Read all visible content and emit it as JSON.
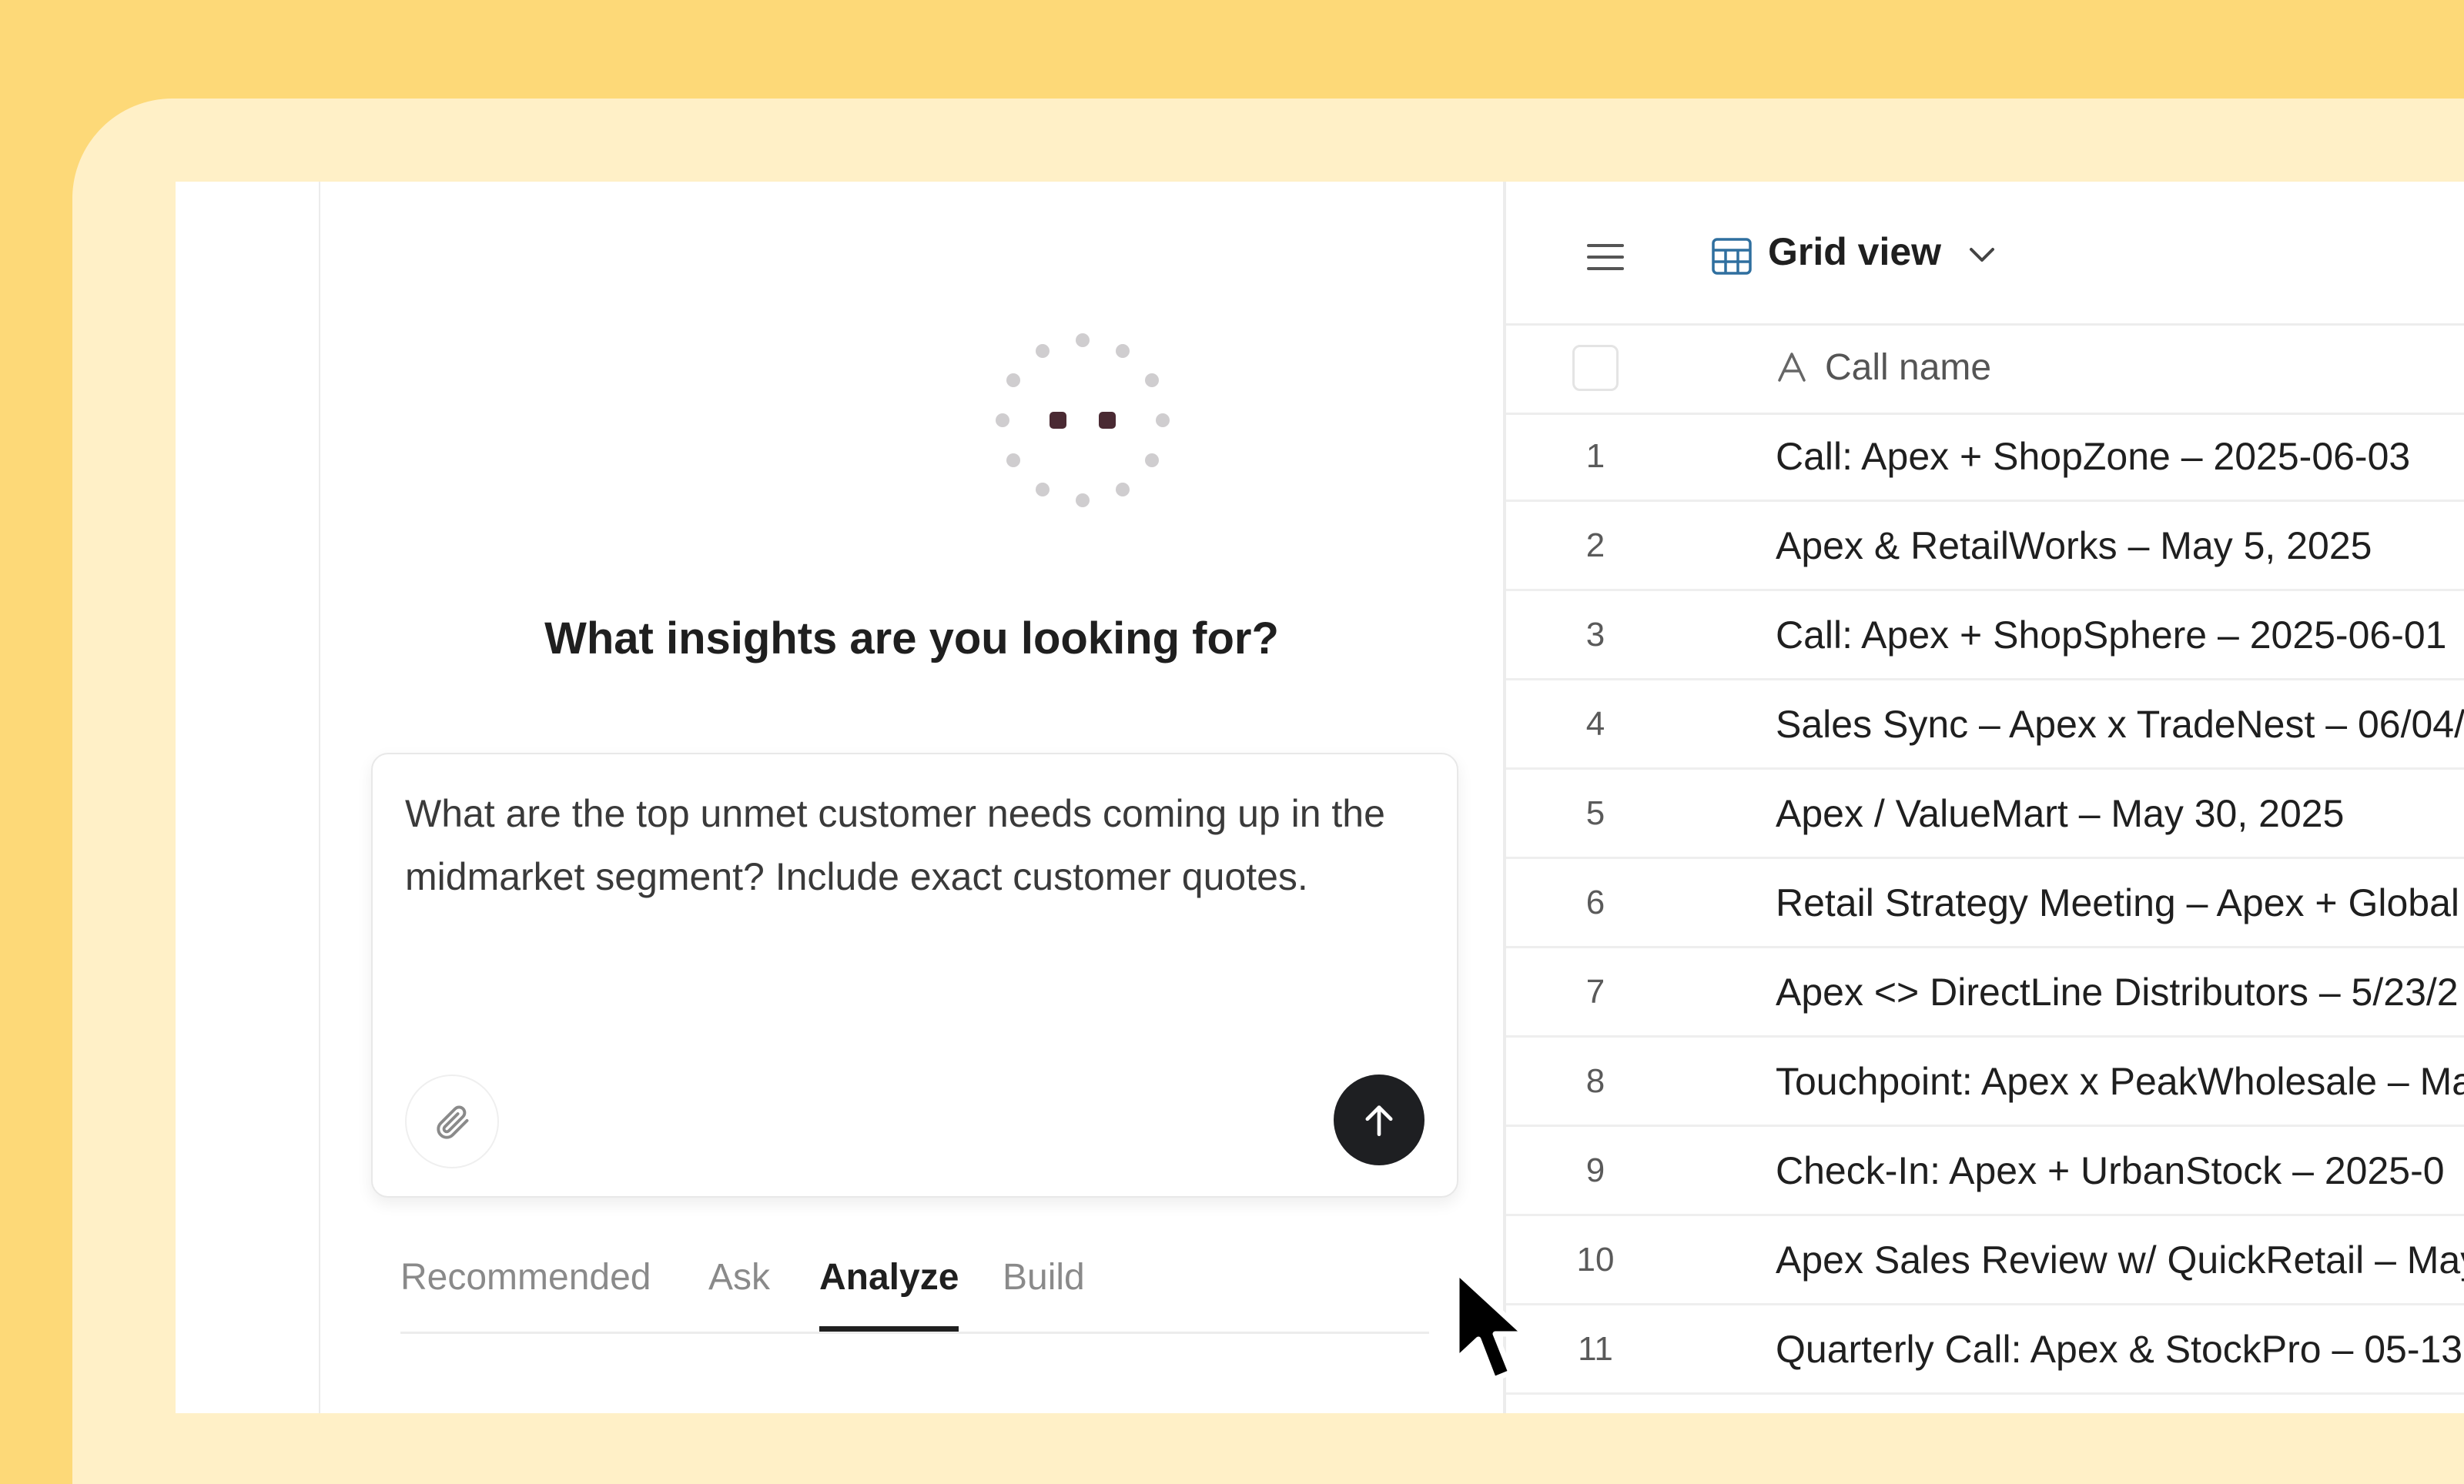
{
  "assistant": {
    "headline": "What insights are you looking for?",
    "prompt_text": "What are the top unmet customer needs coming up in the midmarket segment? Include exact customer quotes.",
    "attach_icon": "paperclip-icon",
    "send_icon": "arrow-up-icon",
    "tabs": [
      {
        "label": "Recommended",
        "active": false
      },
      {
        "label": "Ask",
        "active": false
      },
      {
        "label": "Analyze",
        "active": true
      },
      {
        "label": "Build",
        "active": false
      }
    ]
  },
  "grid": {
    "view_label": "Grid view",
    "column_header": "Call name",
    "rows": [
      {
        "num": "1",
        "name": "Call: Apex + ShopZone – 2025-06-03"
      },
      {
        "num": "2",
        "name": "Apex & RetailWorks – May 5, 2025"
      },
      {
        "num": "3",
        "name": "Call: Apex + ShopSphere – 2025-06-01"
      },
      {
        "num": "4",
        "name": "Sales Sync – Apex x TradeNest – 06/04/"
      },
      {
        "num": "5",
        "name": "Apex / ValueMart – May 30, 2025"
      },
      {
        "num": "6",
        "name": "Retail Strategy Meeting – Apex + Global"
      },
      {
        "num": "7",
        "name": "Apex <> DirectLine Distributors – 5/23/2"
      },
      {
        "num": "8",
        "name": "Touchpoint: Apex x PeakWholesale – Ma"
      },
      {
        "num": "9",
        "name": "Check-In: Apex + UrbanStock – 2025-0"
      },
      {
        "num": "10",
        "name": "Apex Sales Review w/ QuickRetail – May"
      },
      {
        "num": "11",
        "name": "Quarterly Call: Apex & StockPro – 05-13"
      }
    ]
  },
  "colors": {
    "background": "#fdd978",
    "frame": "#fff0c7",
    "send_button": "#1e1f22",
    "spinner_dark": "#4a2a33",
    "grid_icon": "#2f6f9f"
  }
}
